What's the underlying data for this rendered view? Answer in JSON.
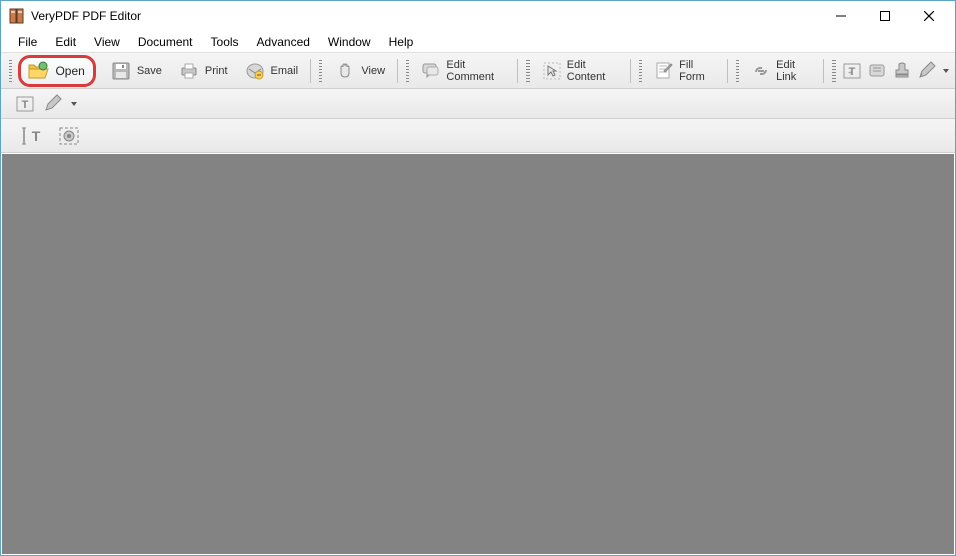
{
  "title": "VeryPDF PDF Editor",
  "menu": [
    "File",
    "Edit",
    "View",
    "Document",
    "Tools",
    "Advanced",
    "Window",
    "Help"
  ],
  "toolbar": {
    "open": "Open",
    "save": "Save",
    "print": "Print",
    "email": "Email",
    "view": "View",
    "edit_comment": "Edit Comment",
    "edit_content": "Edit Content",
    "fill_form": "Fill Form",
    "edit_link": "Edit Link"
  }
}
